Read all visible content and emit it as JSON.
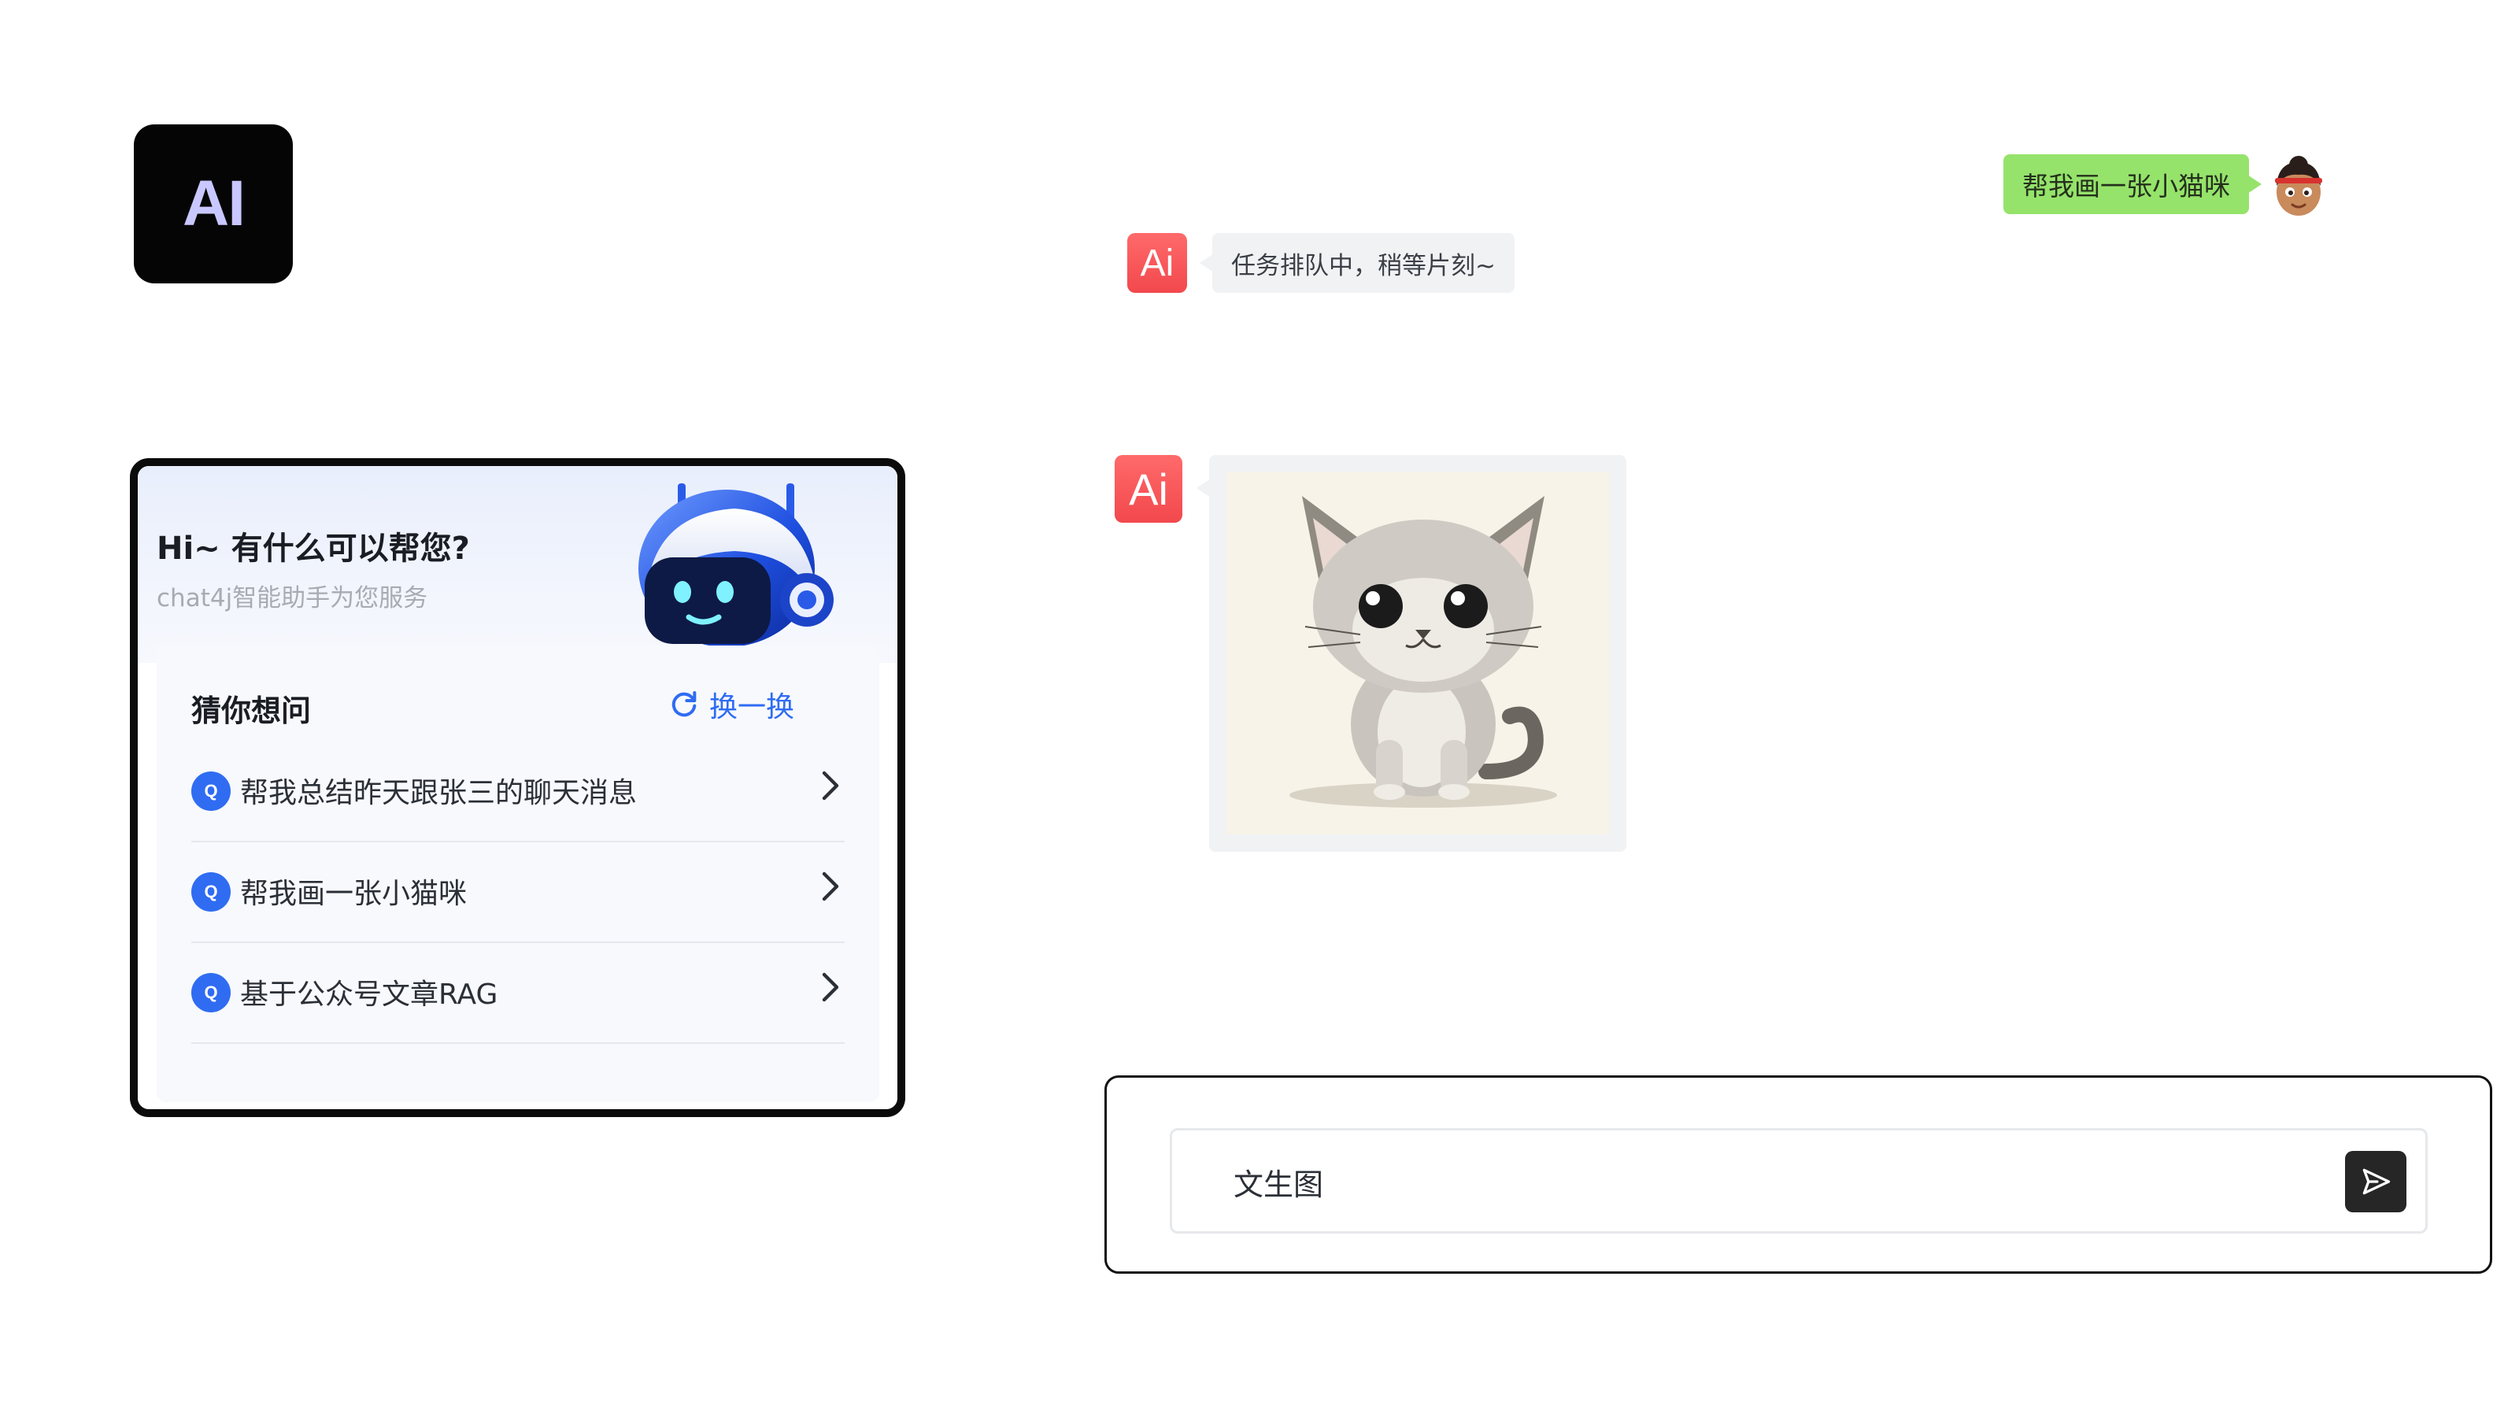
{
  "logo": {
    "text": "AI"
  },
  "assistant_card": {
    "greeting": "Hi~ 有什么可以帮您?",
    "subtitle": "chat4j智能助手为您服务",
    "robot_icon": "robot-mascot-icon",
    "suggestions": {
      "title": "猜你想问",
      "refresh_label": "换一换",
      "refresh_icon": "refresh-icon",
      "badge": "Q",
      "items": [
        {
          "label": "帮我总结昨天跟张三的聊天消息"
        },
        {
          "label": "帮我画一张小猫咪"
        },
        {
          "label": "基于公众号文章RAG"
        }
      ]
    }
  },
  "chat": {
    "messages": [
      {
        "role": "user",
        "text": "帮我画一张小猫咪",
        "avatar_icon": "user-avatar-icon"
      },
      {
        "role": "assistant",
        "avatar_text": "Ai",
        "text": "任务排队中，稍等片刻~"
      },
      {
        "role": "assistant",
        "avatar_text": "Ai",
        "image": "kitten-sketch-image"
      }
    ]
  },
  "composer": {
    "value": "文生图",
    "send_icon": "send-icon"
  },
  "colors": {
    "user_bubble": "#95e36b",
    "ai_avatar": "#f2484d",
    "accent_blue": "#2f6cf2",
    "logo_bg": "#050505",
    "logo_text": "#c9c7ff"
  }
}
